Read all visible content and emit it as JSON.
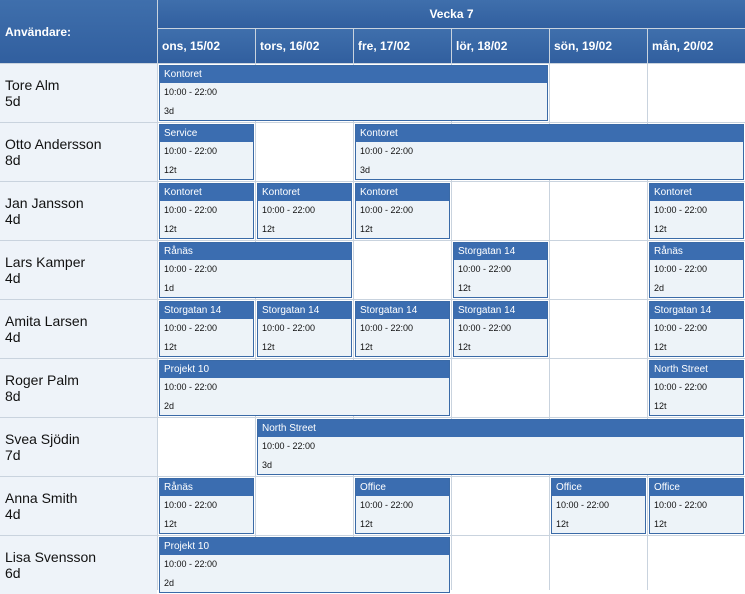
{
  "header": {
    "users_label": "Användare:",
    "week_label": "Vecka 7"
  },
  "days": [
    "ons, 15/02",
    "tors, 16/02",
    "fre, 17/02",
    "lör, 18/02",
    "sön, 19/02",
    "mån, 20/02"
  ],
  "users": [
    {
      "name": "Tore Alm",
      "days": "5d"
    },
    {
      "name": "Otto Andersson",
      "days": "8d"
    },
    {
      "name": "Jan Jansson",
      "days": "4d"
    },
    {
      "name": "Lars Kamper",
      "days": "4d"
    },
    {
      "name": "Amita Larsen",
      "days": "4d"
    },
    {
      "name": "Roger Palm",
      "days": "8d"
    },
    {
      "name": "Svea Sjödin",
      "days": "7d"
    },
    {
      "name": "Anna Smith",
      "days": "4d"
    },
    {
      "name": "Lisa Svensson",
      "days": "6d"
    }
  ],
  "events": [
    {
      "row": 0,
      "col": 0,
      "span": 4,
      "title": "Kontoret",
      "time": "10:00 - 22:00",
      "count": "3d"
    },
    {
      "row": 1,
      "col": 0,
      "span": 1,
      "title": "Service",
      "time": "10:00 - 22:00",
      "count": "12t"
    },
    {
      "row": 1,
      "col": 2,
      "span": 4,
      "title": "Kontoret",
      "time": "10:00 - 22:00",
      "count": "3d"
    },
    {
      "row": 2,
      "col": 0,
      "span": 1,
      "title": "Kontoret",
      "time": "10:00 - 22:00",
      "count": "12t"
    },
    {
      "row": 2,
      "col": 1,
      "span": 1,
      "title": "Kontoret",
      "time": "10:00 - 22:00",
      "count": "12t"
    },
    {
      "row": 2,
      "col": 2,
      "span": 1,
      "title": "Kontoret",
      "time": "10:00 - 22:00",
      "count": "12t"
    },
    {
      "row": 2,
      "col": 5,
      "span": 1,
      "title": "Kontoret",
      "time": "10:00 - 22:00",
      "count": "12t"
    },
    {
      "row": 3,
      "col": 0,
      "span": 2,
      "title": "Rånäs",
      "time": "10:00 - 22:00",
      "count": "1d"
    },
    {
      "row": 3,
      "col": 3,
      "span": 1,
      "title": "Storgatan 14",
      "time": "10:00 - 22:00",
      "count": "12t"
    },
    {
      "row": 3,
      "col": 5,
      "span": 1,
      "title": "Rånäs",
      "time": "10:00 - 22:00",
      "count": "2d"
    },
    {
      "row": 4,
      "col": 0,
      "span": 1,
      "title": "Storgatan 14",
      "time": "10:00 - 22:00",
      "count": "12t"
    },
    {
      "row": 4,
      "col": 1,
      "span": 1,
      "title": "Storgatan 14",
      "time": "10:00 - 22:00",
      "count": "12t"
    },
    {
      "row": 4,
      "col": 2,
      "span": 1,
      "title": "Storgatan 14",
      "time": "10:00 - 22:00",
      "count": "12t"
    },
    {
      "row": 4,
      "col": 3,
      "span": 1,
      "title": "Storgatan 14",
      "time": "10:00 - 22:00",
      "count": "12t"
    },
    {
      "row": 4,
      "col": 5,
      "span": 1,
      "title": "Storgatan 14",
      "time": "10:00 - 22:00",
      "count": "12t"
    },
    {
      "row": 5,
      "col": 0,
      "span": 3,
      "title": "Projekt 10",
      "time": "10:00 - 22:00",
      "count": "2d"
    },
    {
      "row": 5,
      "col": 5,
      "span": 1,
      "title": "North Street",
      "time": "10:00 - 22:00",
      "count": "12t"
    },
    {
      "row": 6,
      "col": 1,
      "span": 5,
      "title": "North Street",
      "time": "10:00 - 22:00",
      "count": "3d"
    },
    {
      "row": 7,
      "col": 0,
      "span": 1,
      "title": "Rånäs",
      "time": "10:00 - 22:00",
      "count": "12t"
    },
    {
      "row": 7,
      "col": 2,
      "span": 1,
      "title": "Office",
      "time": "10:00 - 22:00",
      "count": "12t"
    },
    {
      "row": 7,
      "col": 4,
      "span": 1,
      "title": "Office",
      "time": "10:00 - 22:00",
      "count": "12t"
    },
    {
      "row": 7,
      "col": 5,
      "span": 1,
      "title": "Office",
      "time": "10:00 - 22:00",
      "count": "12t"
    },
    {
      "row": 8,
      "col": 0,
      "span": 3,
      "title": "Projekt 10",
      "time": "10:00 - 22:00",
      "count": "2d"
    }
  ]
}
